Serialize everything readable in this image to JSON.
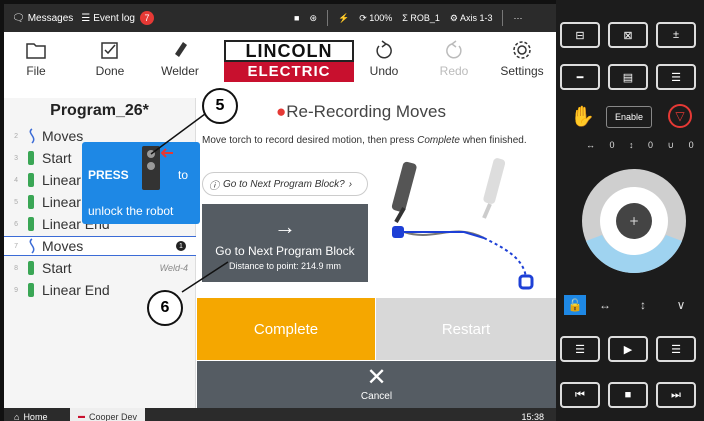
{
  "statusbar": {
    "messages_label": "Messages",
    "eventlog_label": "Event log",
    "eventlog_count": "7",
    "battery": "100%",
    "robot": "ROB_1",
    "axis": "Axis 1-3",
    "more": "···"
  },
  "toolbar": {
    "file": "File",
    "done": "Done",
    "welder": "Welder",
    "undo": "Undo",
    "redo": "Redo",
    "settings": "Settings"
  },
  "logo": {
    "top": "LINCOLN",
    "bottom": "ELECTRIC"
  },
  "program": {
    "title": "Program_26*",
    "rows": [
      {
        "num": "2",
        "label": "Moves",
        "icon": "moves-icon"
      },
      {
        "num": "3",
        "label": "Start",
        "icon": "torch-icon"
      },
      {
        "num": "4",
        "label": "Linear",
        "icon": "torch-icon"
      },
      {
        "num": "5",
        "label": "Linear",
        "icon": "torch-icon"
      },
      {
        "num": "6",
        "label": "Linear End",
        "icon": "torch-icon"
      },
      {
        "num": "7",
        "label": "Moves",
        "icon": "moves-icon",
        "badge": "1"
      },
      {
        "num": "8",
        "label": "Start",
        "icon": "torch-icon",
        "right": "Weld-4"
      },
      {
        "num": "9",
        "label": "Linear End",
        "icon": "torch-icon"
      }
    ]
  },
  "tooltip": {
    "press": "PRESS",
    "to": "to",
    "unlock": "unlock the robot"
  },
  "main": {
    "title": "Re-Recording Moves",
    "instruction_pre": "Move torch to record desired motion, then press ",
    "instruction_em": "Complete",
    "instruction_post": " when finished.",
    "goto_link": "Go to Next Program Block?",
    "goto_btn_label": "Go to Next Program Block",
    "goto_btn_distance": "Distance to point: 214.9 mm",
    "complete": "Complete",
    "restart": "Restart",
    "cancel": "Cancel"
  },
  "callouts": {
    "first": "5",
    "second": "6"
  },
  "taskbar": {
    "home": "Home",
    "task": "Cooper Dev",
    "time": "15:38"
  },
  "panel": {
    "enable": "Enable",
    "jog_labels": "↔ 0 ↕ 0 ∪ 0",
    "mode_items": [
      "↔",
      "↕",
      "∨"
    ]
  }
}
